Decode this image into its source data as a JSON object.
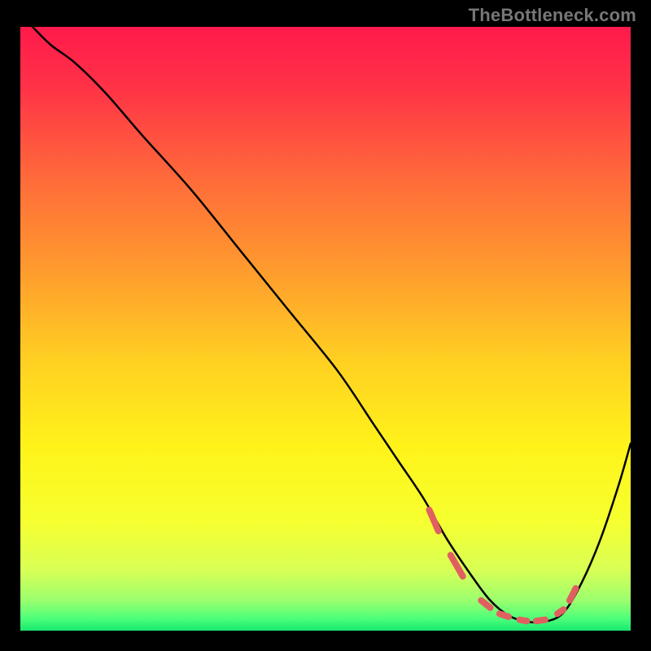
{
  "watermark": "TheBottleneck.com",
  "colors": {
    "frame_bg": "#000000",
    "curve": "#000000",
    "dash": "#e06060",
    "gradient_stops": [
      {
        "offset": 0.0,
        "color": "#ff1a4b"
      },
      {
        "offset": 0.1,
        "color": "#ff3247"
      },
      {
        "offset": 0.25,
        "color": "#ff6a3a"
      },
      {
        "offset": 0.4,
        "color": "#ff9a2e"
      },
      {
        "offset": 0.55,
        "color": "#ffcf22"
      },
      {
        "offset": 0.7,
        "color": "#fff41a"
      },
      {
        "offset": 0.82,
        "color": "#f6ff30"
      },
      {
        "offset": 0.9,
        "color": "#d8ff55"
      },
      {
        "offset": 0.95,
        "color": "#9bff6e"
      },
      {
        "offset": 0.98,
        "color": "#4dff7a"
      },
      {
        "offset": 1.0,
        "color": "#19e86f"
      }
    ]
  },
  "chart_data": {
    "type": "line",
    "title": "",
    "xlabel": "",
    "ylabel": "",
    "x_range": [
      0,
      100
    ],
    "y_range": [
      0,
      100
    ],
    "series": [
      {
        "name": "bottleneck-curve",
        "x": [
          2,
          5,
          9,
          14,
          20,
          28,
          36,
          44,
          52,
          58,
          62,
          66,
          70,
          74,
          77,
          80,
          83,
          86,
          89,
          92,
          95,
          98,
          100
        ],
        "y": [
          100,
          97,
          94,
          89,
          82,
          73,
          63,
          53,
          43,
          34,
          28,
          22,
          15,
          9,
          5,
          2.5,
          1.5,
          1.5,
          3,
          8,
          15,
          24,
          31
        ]
      }
    ],
    "optimal_dash_segments": [
      {
        "x0": 67.0,
        "y0": 20.0,
        "x1": 68.5,
        "y1": 16.5
      },
      {
        "x0": 70.5,
        "y0": 12.5,
        "x1": 72.5,
        "y1": 9.0
      },
      {
        "x0": 75.5,
        "y0": 5.0,
        "x1": 77.0,
        "y1": 3.8
      },
      {
        "x0": 78.5,
        "y0": 2.8,
        "x1": 80.0,
        "y1": 2.3
      },
      {
        "x0": 81.8,
        "y0": 1.8,
        "x1": 83.0,
        "y1": 1.6
      },
      {
        "x0": 84.5,
        "y0": 1.6,
        "x1": 86.0,
        "y1": 1.8
      },
      {
        "x0": 88.0,
        "y0": 2.8,
        "x1": 89.0,
        "y1": 3.5
      },
      {
        "x0": 90.0,
        "y0": 5.0,
        "x1": 91.0,
        "y1": 7.0
      }
    ]
  }
}
